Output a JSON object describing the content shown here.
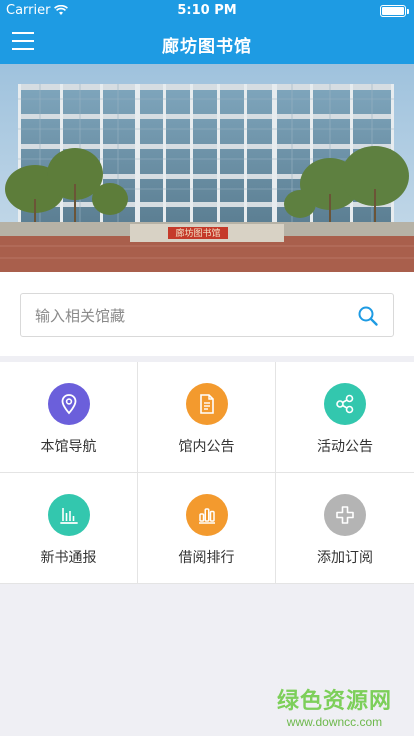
{
  "status_bar": {
    "carrier": "Carrier",
    "time": "5:10 PM"
  },
  "navbar": {
    "title": "廊坊图书馆",
    "menu_icon": "hamburger-menu-icon",
    "background_color": "#1e9be3"
  },
  "banner": {
    "sign_text": "廊坊图书馆"
  },
  "search": {
    "placeholder": "输入相关馆藏",
    "icon": "search-icon"
  },
  "menu_grid": [
    {
      "label": "本馆导航",
      "icon": "location-pin-icon",
      "color": "#6b5fdb"
    },
    {
      "label": "馆内公告",
      "icon": "document-icon",
      "color": "#f39a2e"
    },
    {
      "label": "活动公告",
      "icon": "share-icon",
      "color": "#33c7ae"
    },
    {
      "label": "新书通报",
      "icon": "bar-chart-icon",
      "color": "#33c7ae"
    },
    {
      "label": "借阅排行",
      "icon": "ranking-bars-icon",
      "color": "#f39a2e"
    },
    {
      "label": "添加订阅",
      "icon": "plus-icon",
      "color": "#b4b4b4"
    }
  ],
  "watermark": {
    "title": "绿色资源网",
    "url": "www.downcc.com"
  }
}
